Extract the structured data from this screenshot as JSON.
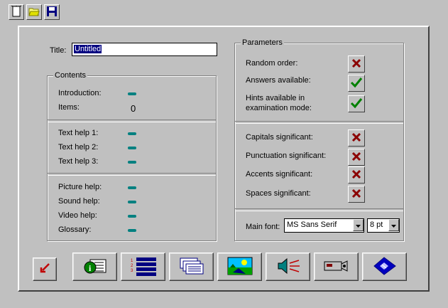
{
  "toolbar": {
    "items": [
      {
        "name": "new-document-icon"
      },
      {
        "name": "open-folder-icon"
      },
      {
        "name": "save-disk-icon"
      }
    ]
  },
  "form": {
    "title_label": "Title:",
    "title_value": "Untitled",
    "contents": {
      "legend": "Contents",
      "introduction": "Introduction:",
      "items": "Items:",
      "items_count": "0",
      "text_help_1": "Text help 1:",
      "text_help_2": "Text help 2:",
      "text_help_3": "Text help 3:",
      "picture_help": "Picture help:",
      "sound_help": "Sound help:",
      "video_help": "Video help:",
      "glossary": "Glossary:"
    },
    "parameters": {
      "legend": "Parameters",
      "random_order": {
        "label": "Random order:",
        "checked": false
      },
      "answers_available": {
        "label": "Answers available:",
        "checked": true
      },
      "hints_line1": "Hints available in",
      "hints_line2": "examination mode:",
      "hints_checked": true,
      "capitals": {
        "label": "Capitals significant:",
        "checked": false
      },
      "punctuation": {
        "label": "Punctuation significant:",
        "checked": false
      },
      "accents": {
        "label": "Accents significant:",
        "checked": false
      },
      "spaces": {
        "label": "Spaces significant:",
        "checked": false
      },
      "main_font_label": "Main font:",
      "main_font_value": "MS Sans Serif",
      "font_size_value": "8 pt"
    }
  },
  "bottom_buttons": [
    {
      "name": "pointer-arrow-icon"
    },
    {
      "name": "info-text-icon"
    },
    {
      "name": "numbered-list-icon"
    },
    {
      "name": "text-cards-icon"
    },
    {
      "name": "picture-icon"
    },
    {
      "name": "sound-speaker-icon"
    },
    {
      "name": "video-camera-icon"
    },
    {
      "name": "glossary-book-icon"
    }
  ],
  "colors": {
    "background": "#c0c0c0",
    "teal_dash": "#008080",
    "cross_red": "#8b0000",
    "check_green": "#008000",
    "selection_blue": "#000080"
  }
}
